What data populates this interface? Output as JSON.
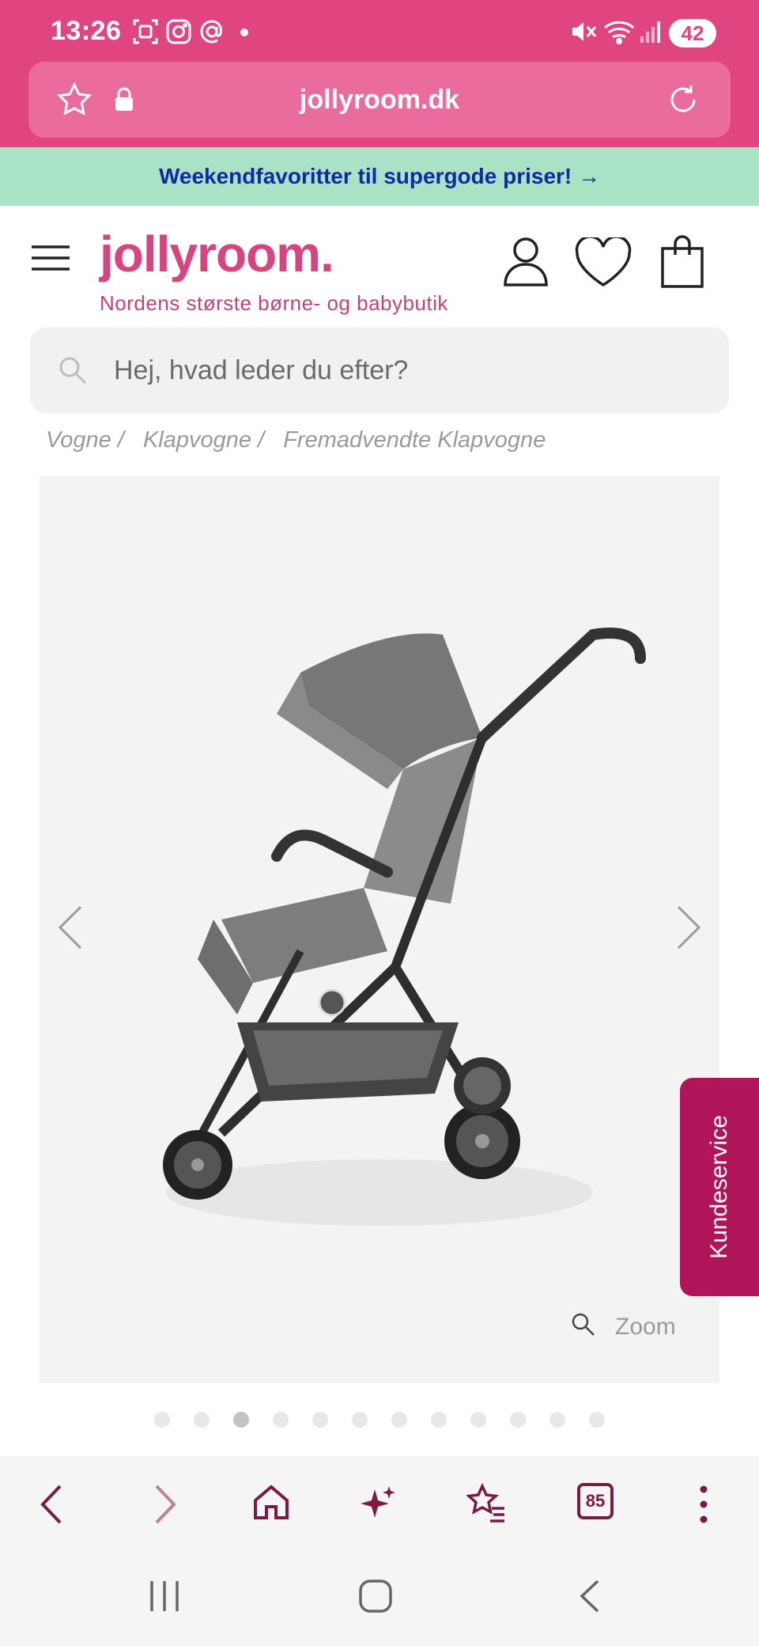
{
  "status_bar": {
    "time": "13:26",
    "battery": "42"
  },
  "browser": {
    "url": "jollyroom.dk",
    "tabs_count": "85"
  },
  "promo": {
    "text": "Weekendfavoritter til supergode priser! →"
  },
  "header": {
    "logo": "jollyroom.",
    "tagline": "Nordens største børne- og babybutik"
  },
  "search": {
    "placeholder": "Hej, hvad leder du efter?"
  },
  "breadcrumb": [
    {
      "label": "Vogne",
      "sep": "/"
    },
    {
      "label": "Klapvogne",
      "sep": "/"
    },
    {
      "label": "Fremadvendte Klapvogne",
      "sep": ""
    }
  ],
  "gallery": {
    "zoom_label": "Zoom",
    "total_images": 12,
    "active_index": 2
  },
  "kundeservice": {
    "label": "Kundeservice"
  },
  "colors": {
    "brand_pink": "#e0457f",
    "logo_pink": "#d8447e",
    "promo_green": "#a9e2c5",
    "promo_text": "#0f2aa3",
    "kundeservice": "#b0155a",
    "toolbar_icon": "#7a1b45"
  }
}
